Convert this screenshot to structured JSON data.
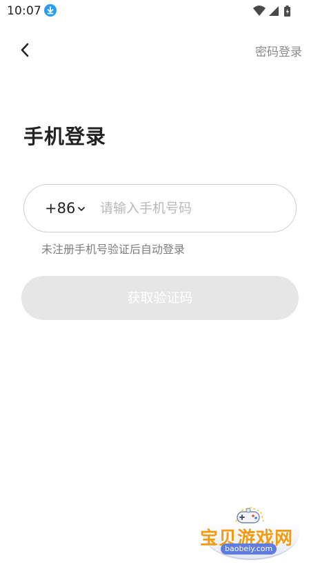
{
  "status_bar": {
    "time": "10:07",
    "download_icon": "download-icon",
    "icons": [
      "wifi-icon",
      "signal-icon",
      "battery-charging-icon"
    ]
  },
  "header": {
    "back_icon": "chevron-left-icon",
    "password_login": "密码登录"
  },
  "title": "手机登录",
  "phone_field": {
    "country_code": "+86",
    "dropdown_icon": "chevron-down-icon",
    "placeholder": "请输入手机号码",
    "value": ""
  },
  "hint": "未注册手机号验证后自动登录",
  "get_code_button": "获取验证码",
  "watermark": {
    "brand": "宝贝游戏网",
    "url": "baobeiy.com",
    "icon": "gamepad-icon"
  },
  "colors": {
    "accent_blue": "#2a9bf3",
    "button_disabled": "#e6e6e6",
    "border": "#cfcfcf",
    "hint_text": "#7d7d7d",
    "watermark_orange": "#f29a10"
  }
}
